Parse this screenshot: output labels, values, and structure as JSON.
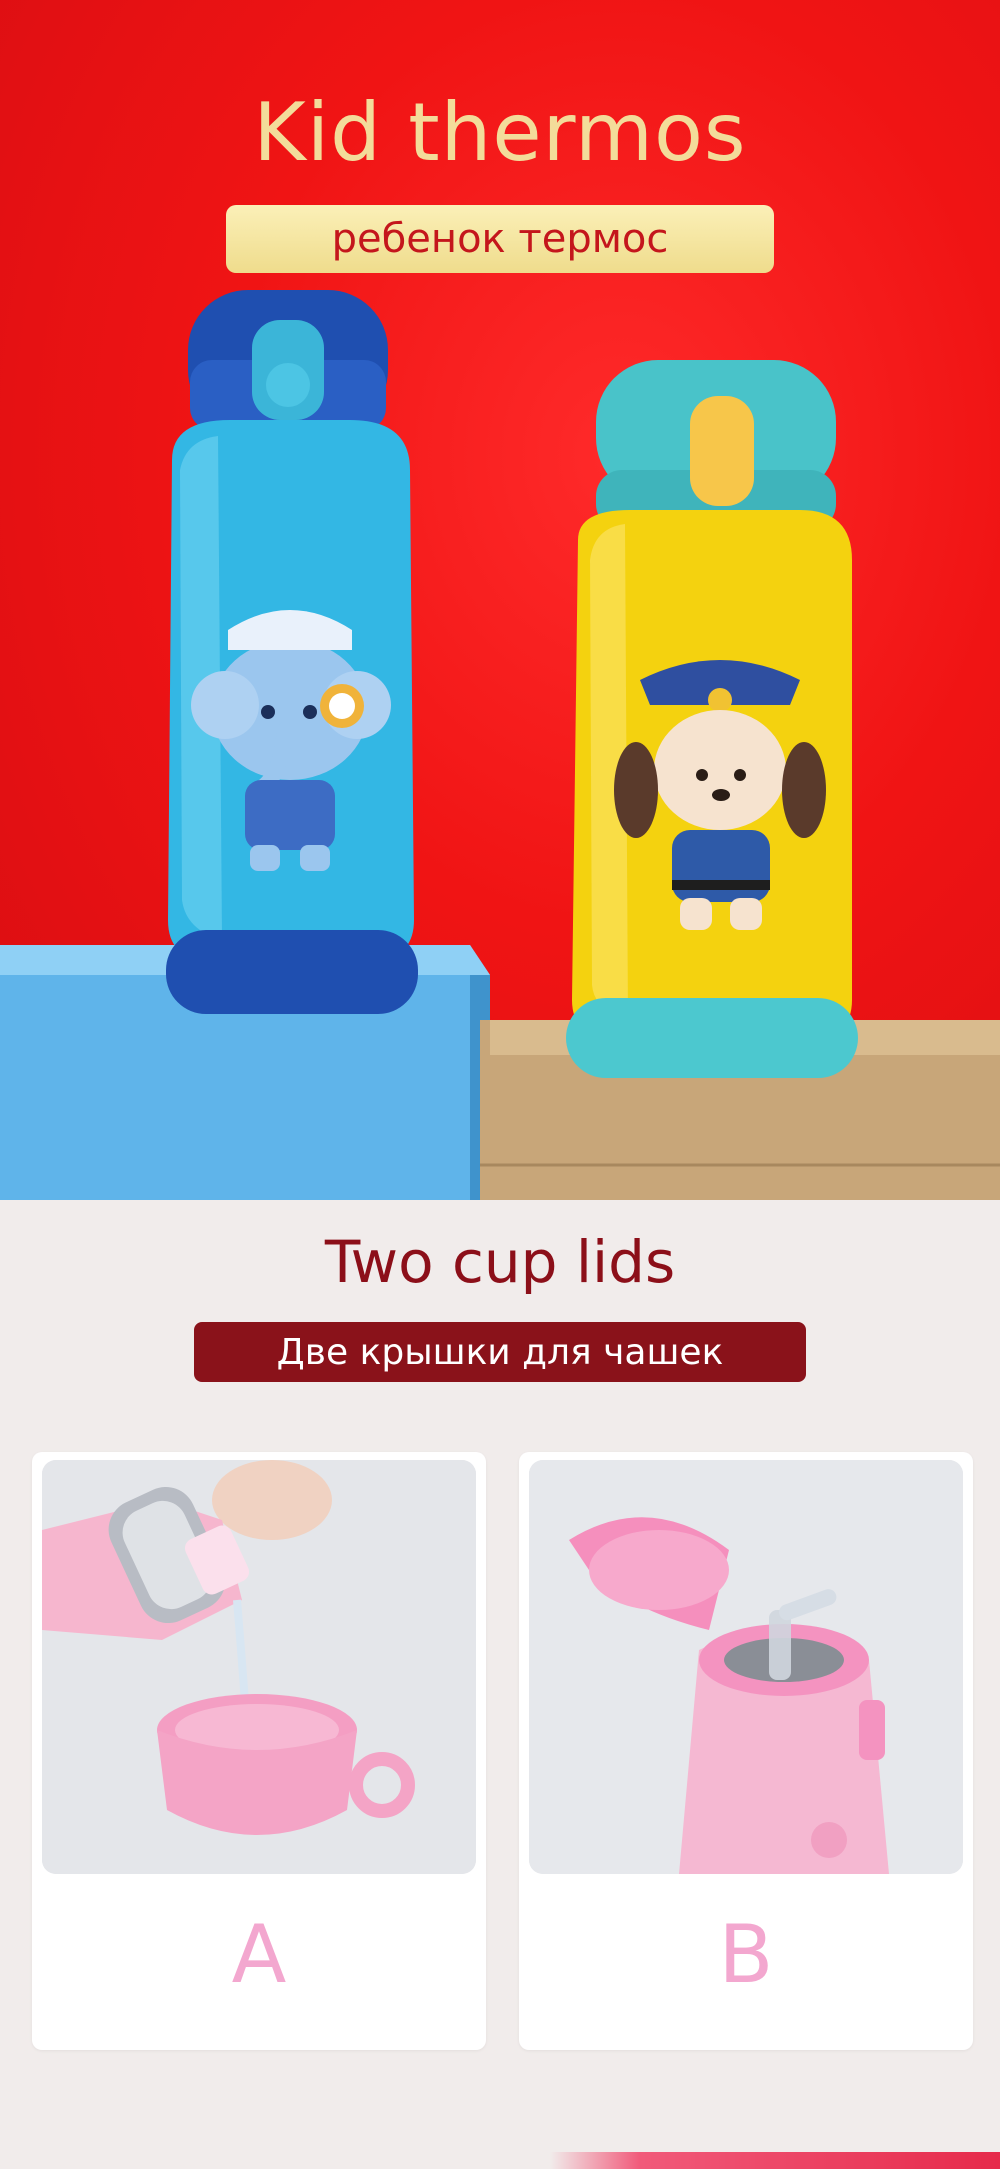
{
  "hero": {
    "title": "Kid thermos",
    "subtitle": "ребенок термос",
    "colors": {
      "background": "#e6121a",
      "title": "#f3dc9a",
      "pill": "#f4e6a3",
      "pill_text": "#c4161c"
    }
  },
  "lids_section": {
    "title": "Two cup lids",
    "subtitle": "Две крышки для чашек",
    "colors": {
      "title": "#8c0f19",
      "pill": "#8a121a",
      "pill_text": "#ffffff",
      "letter": "#f3a7cf"
    },
    "options": [
      {
        "letter": "A"
      },
      {
        "letter": "B"
      }
    ]
  }
}
